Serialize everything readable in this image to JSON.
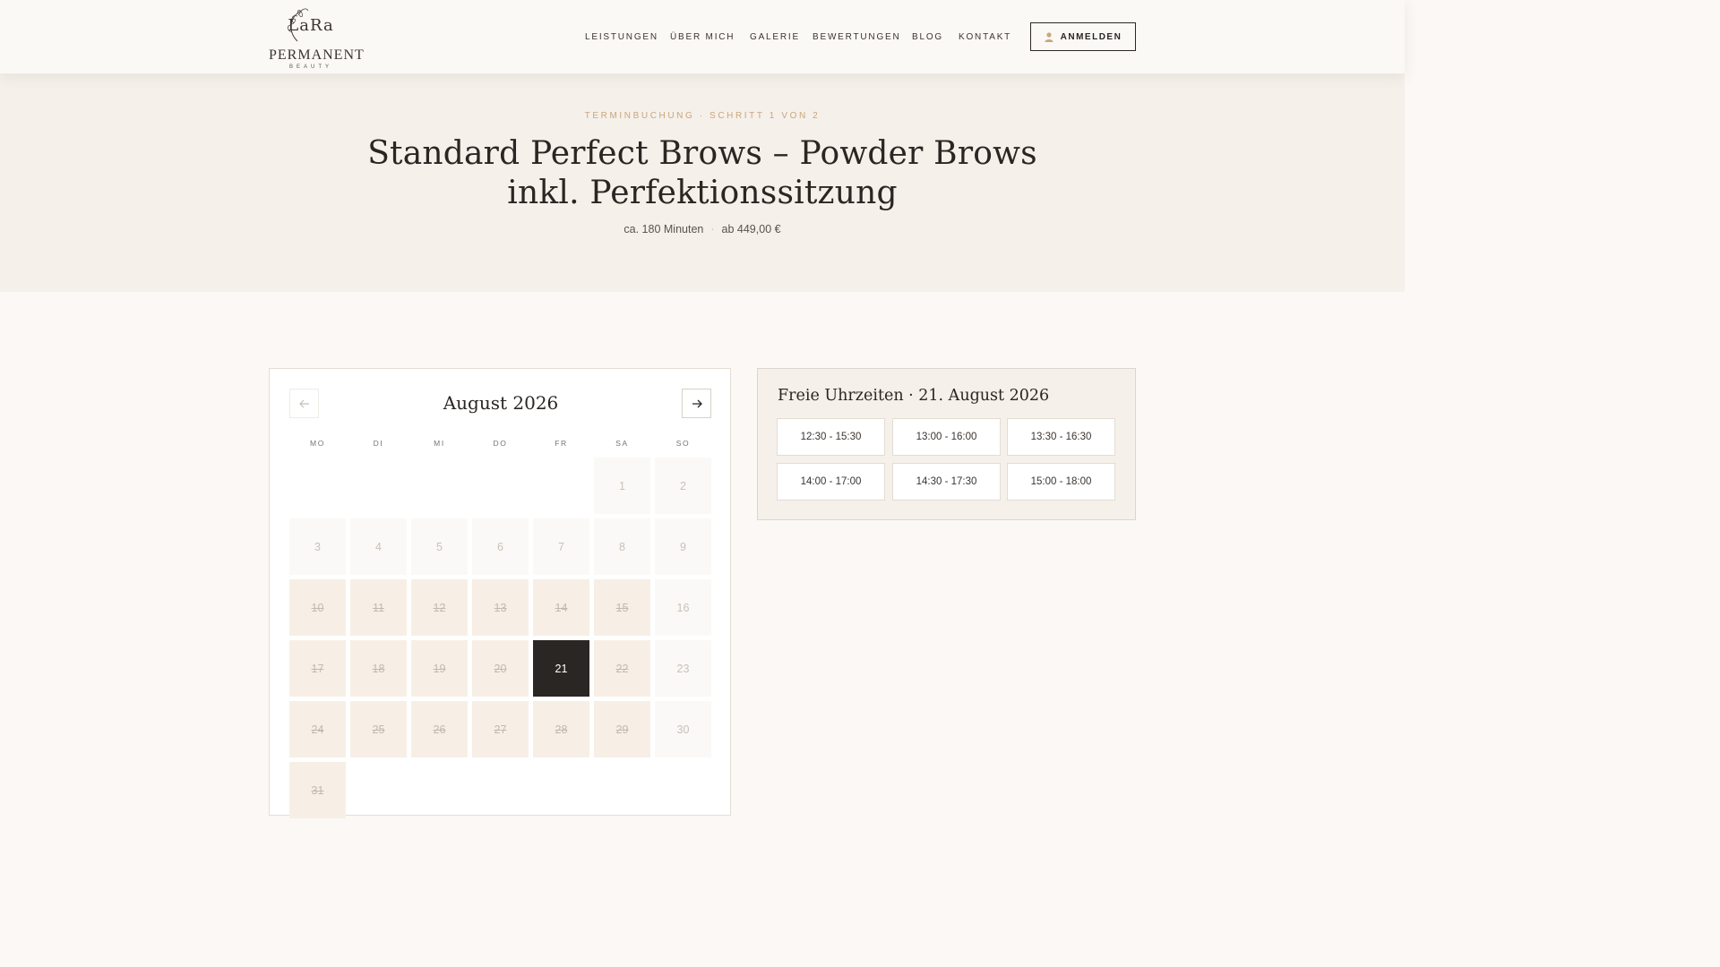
{
  "header": {
    "logo": {
      "name": "LaRa",
      "line1": "PERMANENT",
      "line2": "BEAUTY"
    },
    "nav": [
      {
        "label": "LEISTUNGEN"
      },
      {
        "label": "ÜBER MICH"
      },
      {
        "label": "GALERIE"
      },
      {
        "label": "BEWERTUNGEN"
      },
      {
        "label": "BLOG"
      },
      {
        "label": "KONTAKT"
      }
    ],
    "login_label": "ANMELDEN",
    "login_icon": "user-icon"
  },
  "hero": {
    "eyebrow": "TERMINBUCHUNG · SCHRITT 1 VON 2",
    "title": "Standard Perfect Brows – Powder Brows inkl. Perfektionssitzung",
    "duration": "ca. 180 Minuten",
    "separator": "·",
    "price": "ab 449,00 €"
  },
  "calendar": {
    "month_label": "August 2026",
    "prev_icon": "arrow-left-icon",
    "next_icon": "arrow-right-icon",
    "weekdays": [
      "MO",
      "DI",
      "MI",
      "DO",
      "FR",
      "SA",
      "SO"
    ],
    "days": [
      {
        "label": "1",
        "state": "unavailable"
      },
      {
        "label": "2",
        "state": "unavailable"
      },
      {
        "label": "3",
        "state": "unavailable"
      },
      {
        "label": "4",
        "state": "unavailable"
      },
      {
        "label": "5",
        "state": "unavailable"
      },
      {
        "label": "6",
        "state": "unavailable"
      },
      {
        "label": "7",
        "state": "unavailable"
      },
      {
        "label": "8",
        "state": "unavailable"
      },
      {
        "label": "9",
        "state": "unavailable"
      },
      {
        "label": "10",
        "state": "booked"
      },
      {
        "label": "11",
        "state": "booked"
      },
      {
        "label": "12",
        "state": "booked"
      },
      {
        "label": "13",
        "state": "booked"
      },
      {
        "label": "14",
        "state": "booked"
      },
      {
        "label": "15",
        "state": "booked"
      },
      {
        "label": "16",
        "state": "unavailable"
      },
      {
        "label": "17",
        "state": "booked"
      },
      {
        "label": "18",
        "state": "booked"
      },
      {
        "label": "19",
        "state": "booked"
      },
      {
        "label": "20",
        "state": "booked"
      },
      {
        "label": "21",
        "state": "selected"
      },
      {
        "label": "22",
        "state": "booked"
      },
      {
        "label": "23",
        "state": "unavailable"
      },
      {
        "label": "24",
        "state": "booked"
      },
      {
        "label": "25",
        "state": "booked"
      },
      {
        "label": "26",
        "state": "booked"
      },
      {
        "label": "27",
        "state": "booked"
      },
      {
        "label": "28",
        "state": "booked"
      },
      {
        "label": "29",
        "state": "booked"
      },
      {
        "label": "30",
        "state": "unavailable"
      },
      {
        "label": "31",
        "state": "booked"
      }
    ]
  },
  "times": {
    "title": "Freie Uhrzeiten · 21. August 2026",
    "slots": [
      {
        "label": "12:30 - 15:30"
      },
      {
        "label": "13:00 - 16:00"
      },
      {
        "label": "13:30 - 16:30"
      },
      {
        "label": "14:00 - 17:00"
      },
      {
        "label": "14:30 - 17:30"
      },
      {
        "label": "15:00 - 18:00"
      }
    ]
  },
  "colors": {
    "accent": "#c9a77c",
    "dark": "#2a2623",
    "hero_bg": "#f5f0ea",
    "page_bg": "#fbf8f5"
  }
}
